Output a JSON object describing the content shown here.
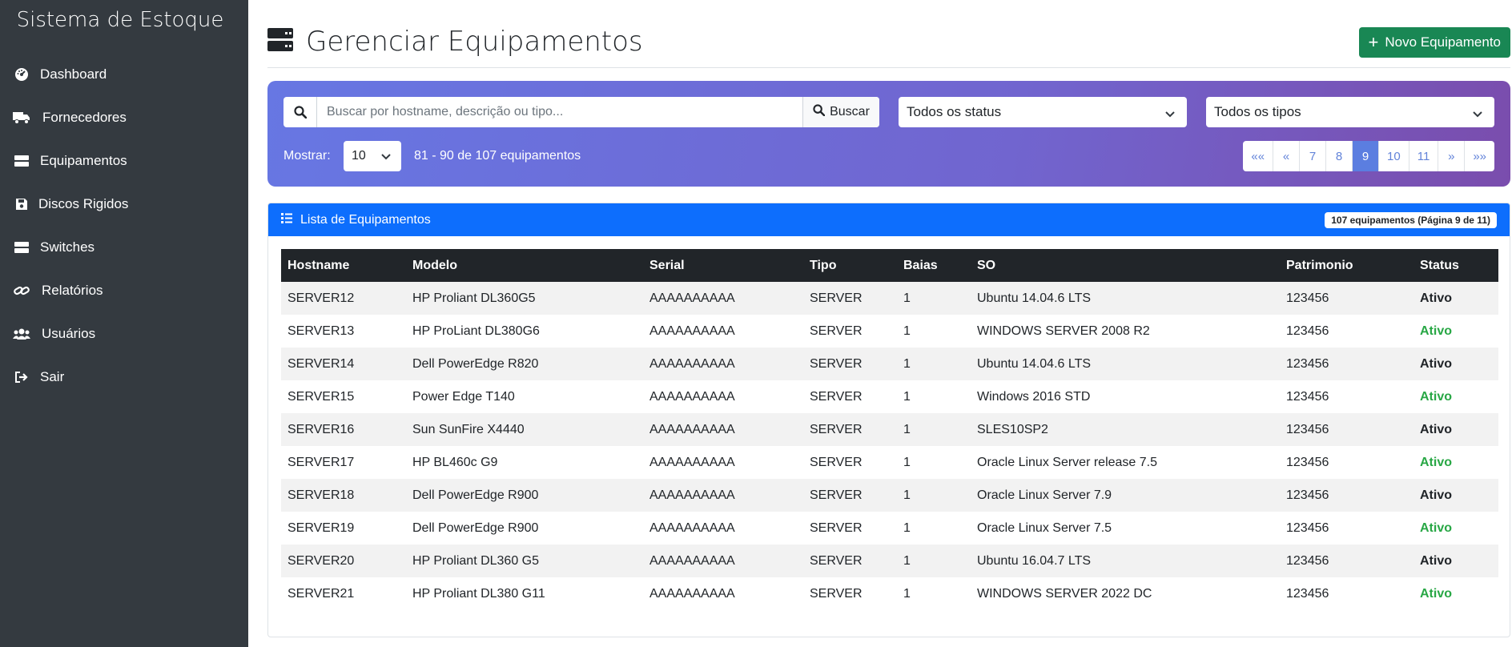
{
  "sidebar": {
    "brand": "Sistema de Estoque",
    "items": [
      {
        "label": "Dashboard",
        "icon": "tachometer-icon"
      },
      {
        "label": "Fornecedores",
        "icon": "truck-icon"
      },
      {
        "label": "Equipamentos",
        "icon": "server-icon"
      },
      {
        "label": "Discos Rigidos",
        "icon": "save-icon"
      },
      {
        "label": "Switches",
        "icon": "switch-icon"
      },
      {
        "label": "Relatórios",
        "icon": "link-icon"
      },
      {
        "label": "Usuários",
        "icon": "users-icon"
      },
      {
        "label": "Sair",
        "icon": "sign-out-icon"
      }
    ]
  },
  "header": {
    "title": "Gerenciar Equipamentos",
    "new_button": "Novo Equipamento"
  },
  "filters": {
    "search_placeholder": "Buscar por hostname, descrição ou tipo...",
    "search_value": "",
    "search_button": "Buscar",
    "status_select": "Todos os status",
    "type_select": "Todos os tipos",
    "show_label": "Mostrar:",
    "per_page": "10",
    "range_text": "81 - 90 de 107 equipamentos"
  },
  "pagination": {
    "first": "««",
    "prev": "«",
    "pages": [
      "7",
      "8",
      "9",
      "10",
      "11"
    ],
    "active_page": "9",
    "next": "»",
    "last": "»»"
  },
  "card": {
    "title": "Lista de Equipamentos",
    "badge": "107 equipamentos (Página 9 de 11)"
  },
  "table": {
    "columns": [
      "Hostname",
      "Modelo",
      "Serial",
      "Tipo",
      "Baias",
      "SO",
      "Patrimonio",
      "Status"
    ],
    "rows": [
      {
        "hostname": "SERVER12",
        "modelo": "HP Proliant DL360G5",
        "serial": "AAAAAAAAAA",
        "tipo": "SERVER",
        "baias": "1",
        "so": "Ubuntu 14.04.6 LTS",
        "patrimonio": "123456",
        "status": "Ativo",
        "status_color": "#212529"
      },
      {
        "hostname": "SERVER13",
        "modelo": "HP ProLiant DL380G6",
        "serial": "AAAAAAAAAA",
        "tipo": "SERVER",
        "baias": "1",
        "so": "WINDOWS SERVER 2008 R2",
        "patrimonio": "123456",
        "status": "Ativo",
        "status_color": "#28a745"
      },
      {
        "hostname": "SERVER14",
        "modelo": "Dell PowerEdge R820",
        "serial": "AAAAAAAAAA",
        "tipo": "SERVER",
        "baias": "1",
        "so": "Ubuntu 14.04.6 LTS",
        "patrimonio": "123456",
        "status": "Ativo",
        "status_color": "#212529"
      },
      {
        "hostname": "SERVER15",
        "modelo": "Power Edge T140",
        "serial": "AAAAAAAAAA",
        "tipo": "SERVER",
        "baias": "1",
        "so": "Windows 2016 STD",
        "patrimonio": "123456",
        "status": "Ativo",
        "status_color": "#28a745"
      },
      {
        "hostname": "SERVER16",
        "modelo": "Sun SunFire X4440",
        "serial": "AAAAAAAAAA",
        "tipo": "SERVER",
        "baias": "1",
        "so": "SLES10SP2",
        "patrimonio": "123456",
        "status": "Ativo",
        "status_color": "#212529"
      },
      {
        "hostname": "SERVER17",
        "modelo": "HP BL460c G9",
        "serial": "AAAAAAAAAA",
        "tipo": "SERVER",
        "baias": "1",
        "so": "Oracle Linux Server release 7.5",
        "patrimonio": "123456",
        "status": "Ativo",
        "status_color": "#28a745"
      },
      {
        "hostname": "SERVER18",
        "modelo": "Dell PowerEdge R900",
        "serial": "AAAAAAAAAA",
        "tipo": "SERVER",
        "baias": "1",
        "so": "Oracle Linux Server 7.9",
        "patrimonio": "123456",
        "status": "Ativo",
        "status_color": "#212529"
      },
      {
        "hostname": "SERVER19",
        "modelo": "Dell PowerEdge R900",
        "serial": "AAAAAAAAAA",
        "tipo": "SERVER",
        "baias": "1",
        "so": "Oracle Linux Server 7.5",
        "patrimonio": "123456",
        "status": "Ativo",
        "status_color": "#28a745"
      },
      {
        "hostname": "SERVER20",
        "modelo": "HP Proliant DL360 G5",
        "serial": "AAAAAAAAAA",
        "tipo": "SERVER",
        "baias": "1",
        "so": "Ubuntu 16.04.7 LTS",
        "patrimonio": "123456",
        "status": "Ativo",
        "status_color": "#212529"
      },
      {
        "hostname": "SERVER21",
        "modelo": "HP Proliant DL380 G11",
        "serial": "AAAAAAAAAA",
        "tipo": "SERVER",
        "baias": "1",
        "so": "WINDOWS SERVER 2022 DC",
        "patrimonio": "123456",
        "status": "Ativo",
        "status_color": "#28a745"
      }
    ]
  },
  "colors": {
    "sidebar_bg": "#343a40",
    "primary": "#0d6efd",
    "success": "#198754",
    "status_green": "#28a745",
    "table_head": "#212529"
  }
}
